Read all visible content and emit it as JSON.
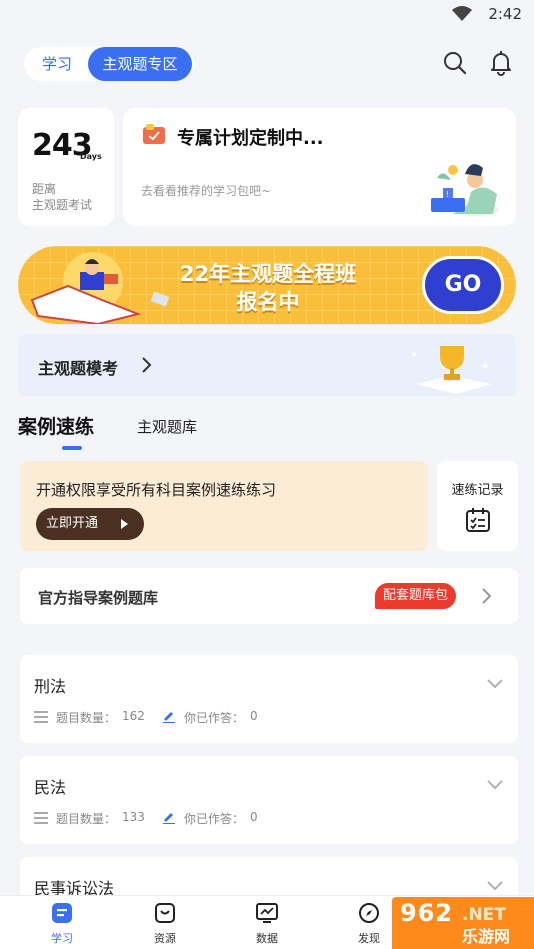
{
  "status": {
    "time": "2:42"
  },
  "header": {
    "tabs": [
      {
        "label": "学习",
        "active": false
      },
      {
        "label": "主观题专区",
        "active": true
      }
    ],
    "icons": [
      "search-icon",
      "bell-icon"
    ]
  },
  "countdown": {
    "days": "243",
    "unit": "Days",
    "line1": "距离",
    "line2": "主观题考试"
  },
  "plan": {
    "title": "专属计划定制中...",
    "subtitle": "去看看推荐的学习包吧~"
  },
  "banner": {
    "line1": "22年主观题全程班",
    "line2": "报名中",
    "button": "GO",
    "bg_color": "#f9bf3a"
  },
  "mock": {
    "label": "主观题模考"
  },
  "content_tabs": [
    {
      "label": "案例速练",
      "active": true
    },
    {
      "label": "主观题库",
      "active": false
    }
  ],
  "promo": {
    "text": "开通权限享受所有科目案例速练练习",
    "button": "立即开通"
  },
  "record": {
    "label": "速练记录"
  },
  "guide": {
    "label": "官方指导案例题库",
    "badge": "配套题库包"
  },
  "subjects": [
    {
      "name": "刑法",
      "count_label": "题目数量：",
      "count": "162",
      "answered_label": "你已作答：",
      "answered": "0"
    },
    {
      "name": "民法",
      "count_label": "题目数量：",
      "count": "133",
      "answered_label": "你已作答：",
      "answered": "0"
    },
    {
      "name": "民事诉讼法"
    }
  ],
  "tabbar": [
    {
      "label": "学习",
      "icon": "study-icon",
      "active": true
    },
    {
      "label": "资源",
      "icon": "resource-icon",
      "active": false
    },
    {
      "label": "数据",
      "icon": "chart-icon",
      "active": false
    },
    {
      "label": "发现",
      "icon": "compass-icon",
      "active": false
    }
  ],
  "watermark": {
    "text_a": "962",
    "text_b": ".NET",
    "text_c": "乐游网"
  },
  "colors": {
    "accent": "#3b6ff2",
    "badge": "#ec3b2d",
    "promo_bg": "#fcecd6"
  }
}
